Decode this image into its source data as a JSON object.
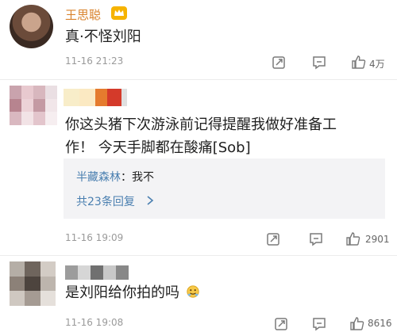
{
  "comments": [
    {
      "username": "王思聪",
      "text": "真·不怪刘阳",
      "time": "11-16 21:23",
      "likes": "4万",
      "accent_color": "#d9822b"
    },
    {
      "text_line1": "你这头猪下次游泳前记得提醒我做好准备工",
      "text_line2": "作！ 今天手脚都在酸痛[Sob]",
      "reply": {
        "author": "半藏森林",
        "separator": "：",
        "text": "我不",
        "more": "共23条回复"
      },
      "time": "11-16 19:09",
      "likes": "2901"
    },
    {
      "text": "是刘阳给你拍的吗",
      "time": "11-16 19:08",
      "likes": "8616"
    }
  ],
  "icons": [
    "share-icon",
    "comment-icon",
    "like-icon",
    "chevron-right-icon",
    "emoji-icon",
    "crown-icon"
  ]
}
